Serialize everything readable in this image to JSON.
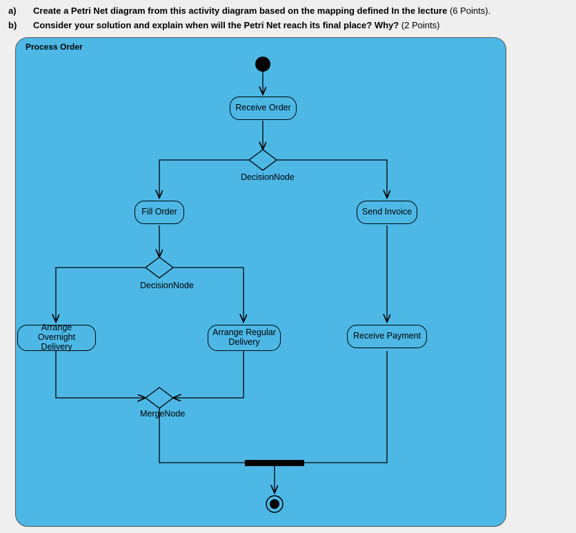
{
  "questions": {
    "a": {
      "label": "a)",
      "text": "Create a Petri Net diagram from this activity diagram based on the mapping defined In the lecture",
      "points": "(6 Points)."
    },
    "b": {
      "label": "b)",
      "text": "Consider your solution and explain when will the Petri Net reach its final place? Why?",
      "points": "(2 Points)"
    }
  },
  "diagram": {
    "frame_title": "Process Order",
    "nodes": {
      "receive_order": "Receive Order",
      "fill_order": "Fill Order",
      "send_invoice": "Send Invoice",
      "arrange_overnight": "Arrange Overnight Delivery",
      "arrange_regular": "Arrange Regular Delivery",
      "receive_payment": "Receive Payment"
    },
    "labels": {
      "decision1": "DecisionNode",
      "decision2": "DecisionNode",
      "merge": "MergeNode"
    }
  },
  "chart_data": {
    "type": "activity-diagram",
    "title": "Process Order",
    "initial_node": "start",
    "final_node": "end",
    "activities": [
      "Receive Order",
      "Fill Order",
      "Send Invoice",
      "Arrange Overnight Delivery",
      "Arrange Regular Delivery",
      "Receive Payment"
    ],
    "control_nodes": [
      {
        "id": "decision1",
        "type": "decision",
        "label": "DecisionNode"
      },
      {
        "id": "decision2",
        "type": "decision",
        "label": "DecisionNode"
      },
      {
        "id": "merge1",
        "type": "merge",
        "label": "MergeNode"
      },
      {
        "id": "join1",
        "type": "join"
      }
    ],
    "edges": [
      {
        "from": "start",
        "to": "Receive Order"
      },
      {
        "from": "Receive Order",
        "to": "decision1"
      },
      {
        "from": "decision1",
        "to": "Fill Order"
      },
      {
        "from": "decision1",
        "to": "Send Invoice"
      },
      {
        "from": "Fill Order",
        "to": "decision2"
      },
      {
        "from": "decision2",
        "to": "Arrange Overnight Delivery"
      },
      {
        "from": "decision2",
        "to": "Arrange Regular Delivery"
      },
      {
        "from": "Arrange Overnight Delivery",
        "to": "merge1"
      },
      {
        "from": "Arrange Regular Delivery",
        "to": "merge1"
      },
      {
        "from": "Send Invoice",
        "to": "Receive Payment"
      },
      {
        "from": "merge1",
        "to": "join1"
      },
      {
        "from": "Receive Payment",
        "to": "join1"
      },
      {
        "from": "join1",
        "to": "end"
      }
    ]
  }
}
